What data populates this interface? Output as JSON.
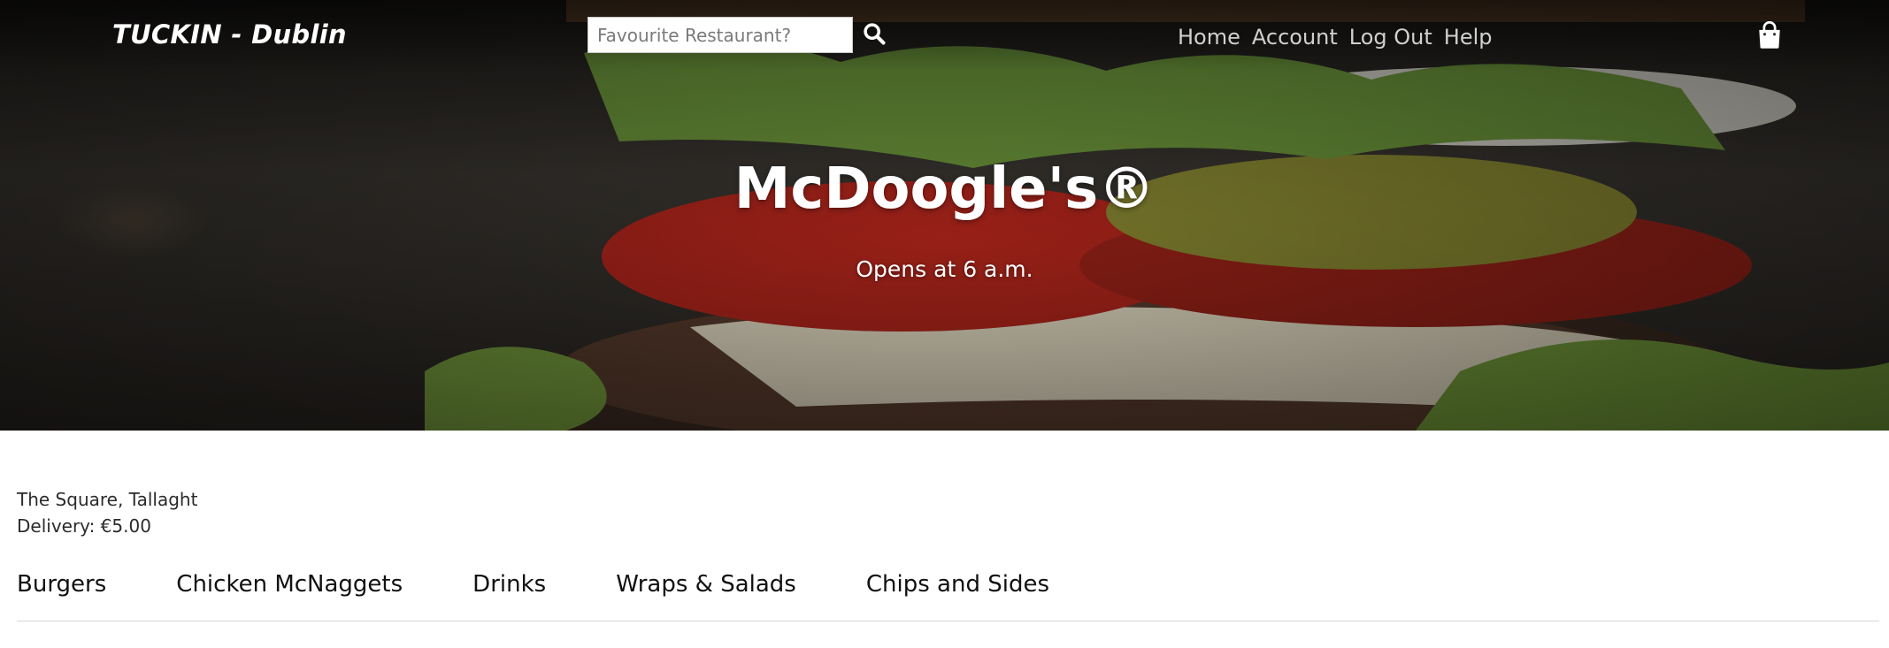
{
  "header": {
    "brand": "TUCKIN - Dublin",
    "search": {
      "placeholder": "Favourite Restaurant?",
      "value": "",
      "icon": "search-icon"
    },
    "nav": [
      "Home",
      "Account",
      "Log Out",
      "Help"
    ],
    "cart_icon": "shopping-bag-icon"
  },
  "hero": {
    "title": "McDoogle's®",
    "subtitle": "Opens at 6 a.m."
  },
  "restaurant": {
    "address": "The Square, Tallaght",
    "delivery_label": "Delivery:",
    "delivery_fee": "€5.00"
  },
  "categories": [
    "Burgers",
    "Chicken McNaggets",
    "Drinks",
    "Wraps & Salads",
    "Chips and Sides"
  ]
}
